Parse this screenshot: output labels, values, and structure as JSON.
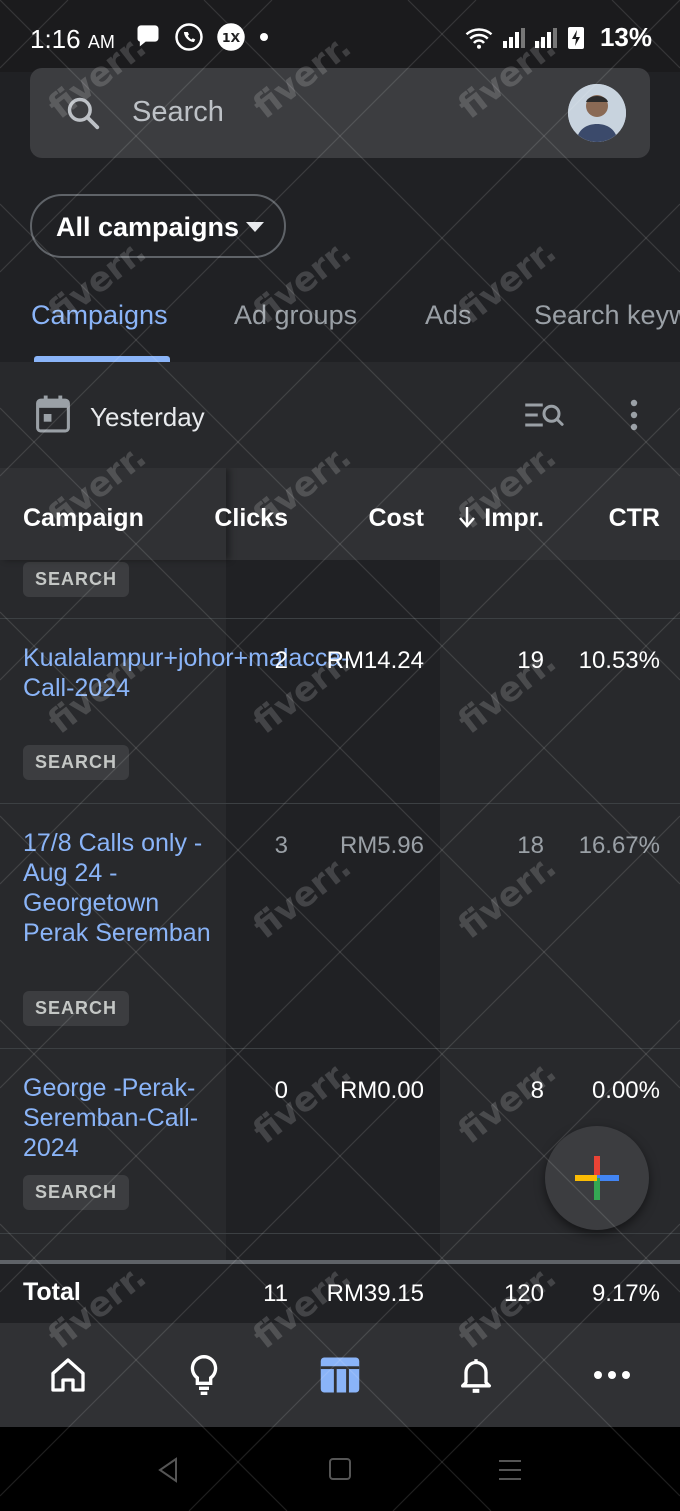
{
  "status": {
    "time": "1:16",
    "ampm": "AM",
    "battery": "13%"
  },
  "search": {
    "placeholder": "Search"
  },
  "filter": {
    "label": "All campaigns"
  },
  "tabs": [
    {
      "label": "Campaigns"
    },
    {
      "label": "Ad groups"
    },
    {
      "label": "Ads"
    },
    {
      "label": "Search keywords"
    }
  ],
  "date_range": {
    "label": "Yesterday"
  },
  "table": {
    "headers": {
      "campaign": "Campaign",
      "clicks": "Clicks",
      "cost": "Cost",
      "impr": "Impr.",
      "ctr": "CTR"
    },
    "partial_badge": "SEARCH",
    "rows": [
      {
        "name": "Kualalampur+johor+malacca-Call-2024",
        "type": "SEARCH",
        "clicks": "2",
        "cost": "RM14.24",
        "impr": "19",
        "ctr": "10.53%"
      },
      {
        "name": "17/8 Calls only - Aug 24 - Georgetown Perak Seremban",
        "type": "SEARCH",
        "clicks": "3",
        "cost": "RM5.96",
        "impr": "18",
        "ctr": "16.67%"
      },
      {
        "name": "George -Perak-Seremban-Call-2024",
        "type": "SEARCH",
        "clicks": "0",
        "cost": "RM0.00",
        "impr": "8",
        "ctr": "0.00%"
      }
    ],
    "total": {
      "label": "Total",
      "clicks": "11",
      "cost": "RM39.15",
      "impr": "120",
      "ctr": "9.17%"
    }
  },
  "watermark": "fiverr.",
  "colors": {
    "accent": "#8ab4f8",
    "background": "#202124",
    "surface": "#28292c"
  }
}
